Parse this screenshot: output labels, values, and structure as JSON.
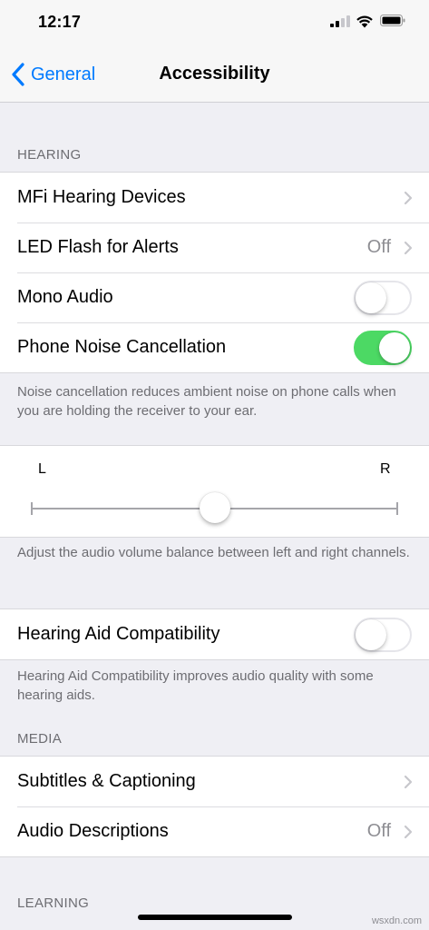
{
  "status_bar": {
    "time": "12:17",
    "signal_icon": "cellular-signal-icon",
    "wifi_icon": "wifi-icon",
    "battery_icon": "battery-icon"
  },
  "nav": {
    "back_label": "General",
    "title": "Accessibility"
  },
  "hearing": {
    "header": "HEARING",
    "rows": [
      {
        "label": "MFi Hearing Devices",
        "value": "",
        "accessory": "chevron"
      },
      {
        "label": "LED Flash for Alerts",
        "value": "Off",
        "accessory": "chevron"
      },
      {
        "label": "Mono Audio",
        "toggle": false
      },
      {
        "label": "Phone Noise Cancellation",
        "toggle": true
      }
    ],
    "footer": "Noise cancellation reduces ambient noise on phone calls when you are holding the receiver to your ear."
  },
  "balance": {
    "left_label": "L",
    "right_label": "R",
    "value": 0.5,
    "footer": "Adjust the audio volume balance between left and right channels."
  },
  "hac": {
    "label": "Hearing Aid Compatibility",
    "toggle": false,
    "footer": "Hearing Aid Compatibility improves audio quality with some hearing aids."
  },
  "media": {
    "header": "MEDIA",
    "rows": [
      {
        "label": "Subtitles & Captioning",
        "value": "",
        "accessory": "chevron"
      },
      {
        "label": "Audio Descriptions",
        "value": "Off",
        "accessory": "chevron"
      }
    ]
  },
  "learning": {
    "header": "LEARNING"
  },
  "watermark": "wsxdn.com",
  "colors": {
    "accent": "#007aff",
    "toggle_on": "#4cd964",
    "background": "#efeff4"
  }
}
